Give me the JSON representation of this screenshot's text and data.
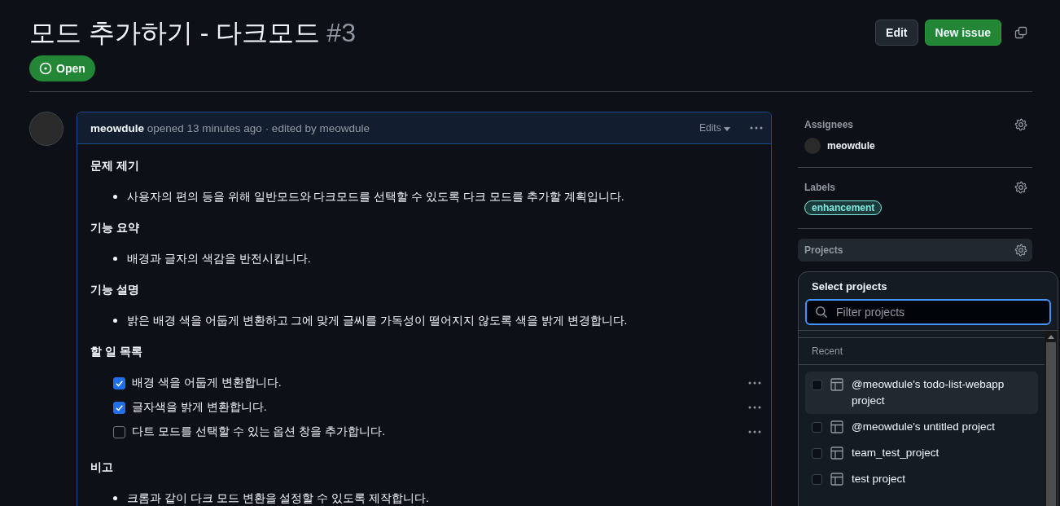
{
  "issue": {
    "title": "모드 추가하기 - 다크모드",
    "number": "#3",
    "open": true,
    "state_label": "Open"
  },
  "header_buttons": {
    "edit": "Edit",
    "new_issue": "New issue"
  },
  "comment": {
    "author": "meowdule",
    "meta": "opened 13 minutes ago · edited by meowdule",
    "edits": "Edits",
    "blocks": [
      {
        "kind": "heading",
        "text": "문제 제기"
      },
      {
        "kind": "bullet",
        "text": "사용자의 편의 등을 위해 일반모드와 다크모드를 선택할 수 있도록 다크 모드를 추가할 계획입니다."
      },
      {
        "kind": "heading",
        "text": "기능 요약"
      },
      {
        "kind": "bullet",
        "text": "배경과 글자의 색감을 반전시킵니다."
      },
      {
        "kind": "heading",
        "text": "기능 설명"
      },
      {
        "kind": "bullet",
        "text": "밝은 배경 색을 어둡게 변환하고 그에 맞게 글씨를 가독성이 떨어지지 않도록 색을 밝게 변경합니다."
      },
      {
        "kind": "heading",
        "text": "할 일 목록"
      },
      {
        "kind": "task",
        "text": "배경 색을 어둡게 변환합니다.",
        "checked": true
      },
      {
        "kind": "task",
        "text": "글자색을 밝게 변환합니다.",
        "checked": true
      },
      {
        "kind": "task",
        "text": "다트 모드를 선택할 수 있는 옵션 창을 추가합니다.",
        "checked": false
      },
      {
        "kind": "heading",
        "text": "비고"
      },
      {
        "kind": "bullet",
        "text": "크롬과 같이 다크 모드 변환을 설정할 수 있도록 제작합니다."
      }
    ]
  },
  "sidebar": {
    "assignees": {
      "title": "Assignees",
      "users": [
        "meowdule"
      ]
    },
    "labels": {
      "title": "Labels",
      "items": [
        {
          "name": "enhancement",
          "color": "#7ee8e0"
        }
      ]
    },
    "projects": {
      "title": "Projects"
    }
  },
  "project_menu": {
    "title": "Select projects",
    "search": {
      "placeholder": "Filter projects"
    },
    "section": "Recent",
    "items": [
      {
        "name": "@meowdule's todo-list-webapp project",
        "checked": false,
        "highlighted": true
      },
      {
        "name": "@meowdule's untitled project",
        "checked": false,
        "highlighted": false
      },
      {
        "name": "team_test_project",
        "checked": false,
        "highlighted": false
      },
      {
        "name": "test project",
        "checked": false,
        "highlighted": false
      }
    ]
  }
}
